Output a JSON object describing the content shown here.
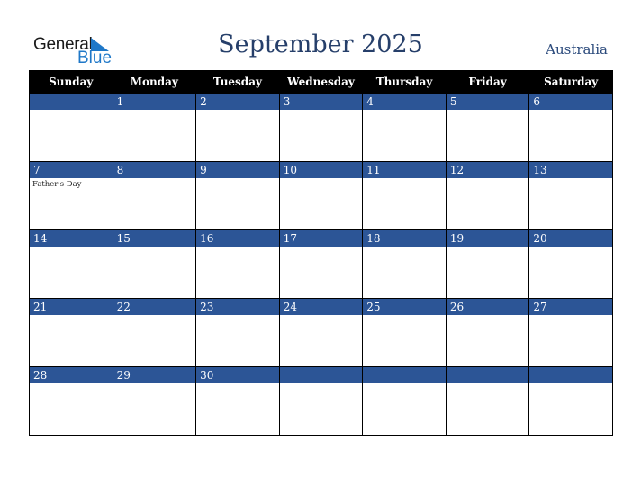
{
  "logo": {
    "line1": "General",
    "line2": "Blue",
    "icon": "triangle-flag-icon"
  },
  "title": "September 2025",
  "country": "Australia",
  "colors": {
    "header_bg": "#000000",
    "date_band": "#2c5596",
    "title": "#263f6a",
    "logo_blue": "#1f78c8"
  },
  "weekdays": [
    "Sunday",
    "Monday",
    "Tuesday",
    "Wednesday",
    "Thursday",
    "Friday",
    "Saturday"
  ],
  "weeks": [
    [
      {
        "day": ""
      },
      {
        "day": "1"
      },
      {
        "day": "2"
      },
      {
        "day": "3"
      },
      {
        "day": "4"
      },
      {
        "day": "5"
      },
      {
        "day": "6"
      }
    ],
    [
      {
        "day": "7",
        "event": "Father's Day"
      },
      {
        "day": "8"
      },
      {
        "day": "9"
      },
      {
        "day": "10"
      },
      {
        "day": "11"
      },
      {
        "day": "12"
      },
      {
        "day": "13"
      }
    ],
    [
      {
        "day": "14"
      },
      {
        "day": "15"
      },
      {
        "day": "16"
      },
      {
        "day": "17"
      },
      {
        "day": "18"
      },
      {
        "day": "19"
      },
      {
        "day": "20"
      }
    ],
    [
      {
        "day": "21"
      },
      {
        "day": "22"
      },
      {
        "day": "23"
      },
      {
        "day": "24"
      },
      {
        "day": "25"
      },
      {
        "day": "26"
      },
      {
        "day": "27"
      }
    ],
    [
      {
        "day": "28"
      },
      {
        "day": "29"
      },
      {
        "day": "30"
      },
      {
        "day": ""
      },
      {
        "day": ""
      },
      {
        "day": ""
      },
      {
        "day": ""
      }
    ]
  ]
}
